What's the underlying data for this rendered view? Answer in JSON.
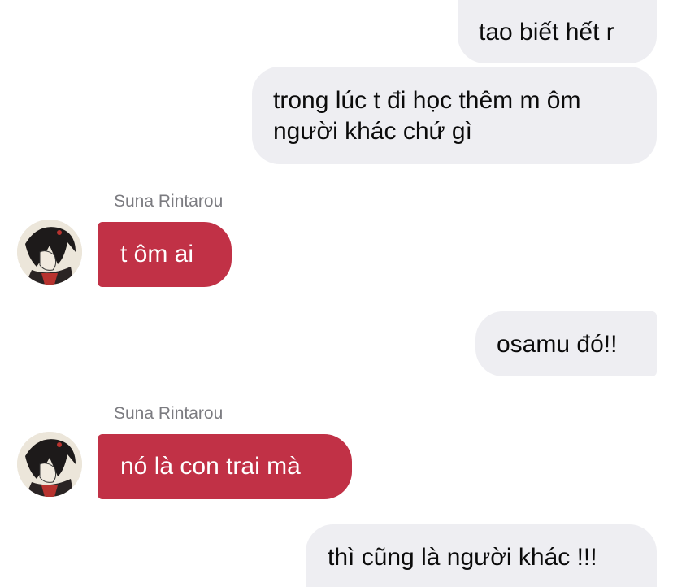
{
  "messages": [
    {
      "side": "sent",
      "text": "tao biết hết r"
    },
    {
      "side": "sent",
      "text": "trong lúc t đi học thêm m ôm\nngười khác chứ gì"
    },
    {
      "side": "received",
      "sender": "Suna Rintarou",
      "text": "t ôm ai"
    },
    {
      "side": "sent",
      "text": "osamu đó!!"
    },
    {
      "side": "received",
      "sender": "Suna Rintarou",
      "text": "nó là con trai mà"
    },
    {
      "side": "sent",
      "text": "thì cũng là người khác !!!"
    }
  ],
  "colors": {
    "sent_bubble": "#eeeef2",
    "received_bubble": "#c13146",
    "sender_name": "#7b7b80"
  }
}
